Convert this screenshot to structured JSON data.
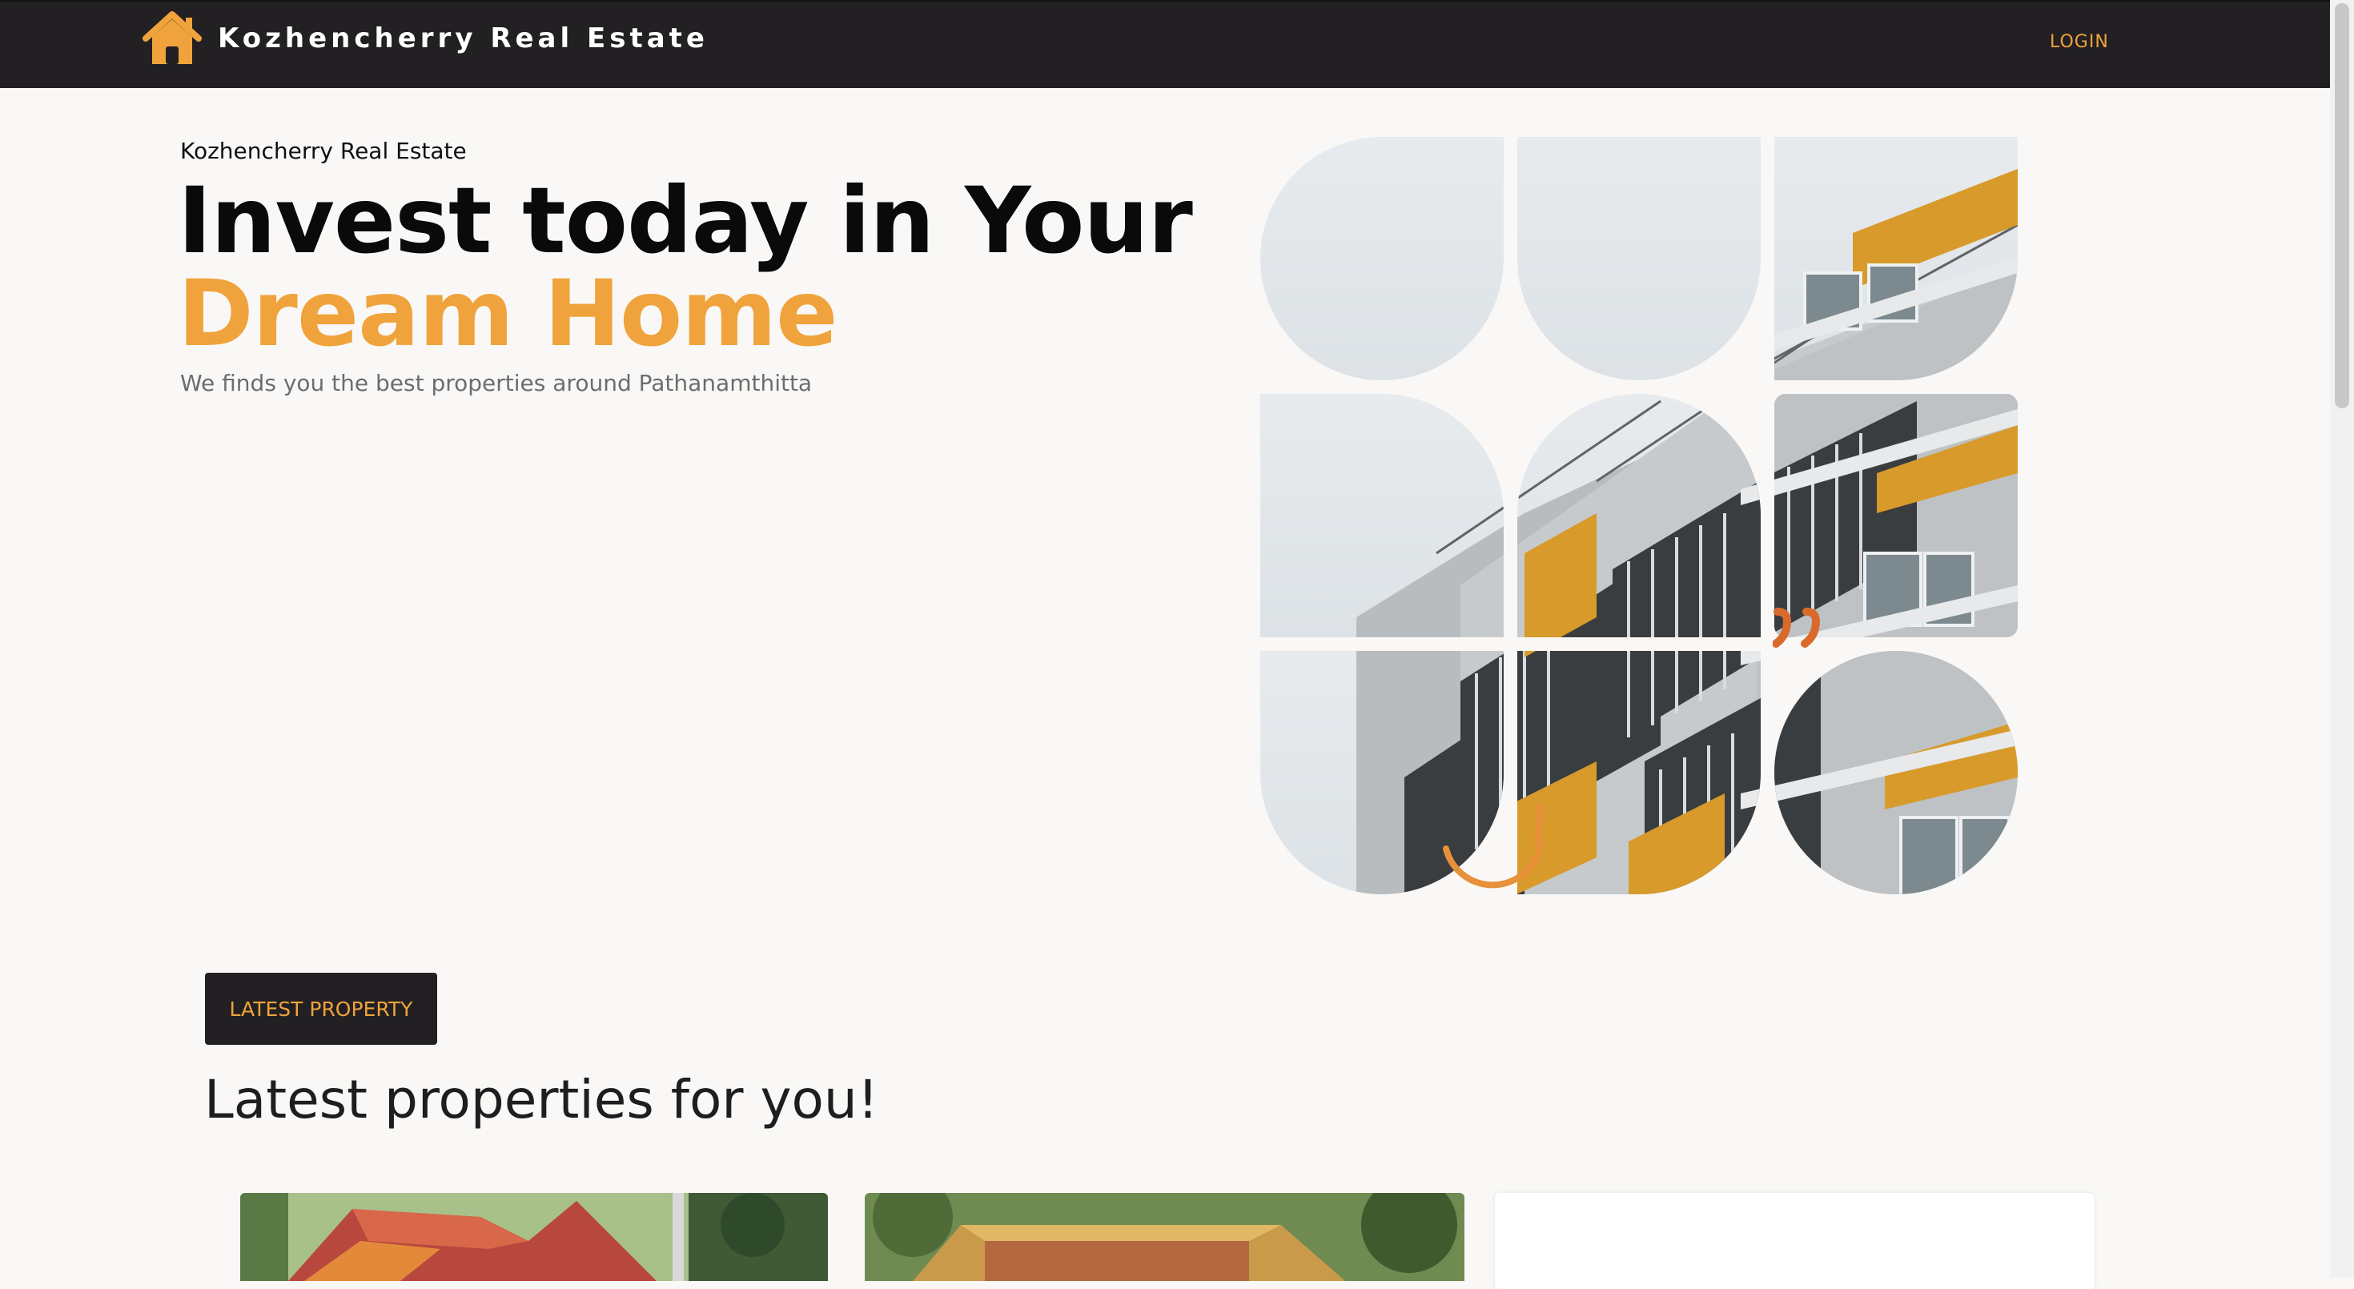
{
  "navbar": {
    "brand_name": "Kozhencherry Real Estate",
    "brand_icon": "house-icon",
    "login_label": "LOGIN"
  },
  "hero": {
    "eyebrow": "Kozhencherry Real Estate",
    "headline_line1": "Invest today in Your",
    "headline_line2": "Dream Home",
    "tagline": "We finds you the best properties around Pathanamthitta",
    "image_description": "building-mosaic-image"
  },
  "latest": {
    "button_label": "LATEST PROPERTY",
    "title": "Latest properties for you!",
    "cards": [
      {
        "image": "house-with-red-tiled-roof"
      },
      {
        "image": "house-under-trees"
      },
      {
        "image": "blank-card"
      }
    ]
  },
  "colors": {
    "accent": "#f0a33c",
    "navbar_bg": "#222022",
    "page_bg": "#f9f8f6"
  }
}
